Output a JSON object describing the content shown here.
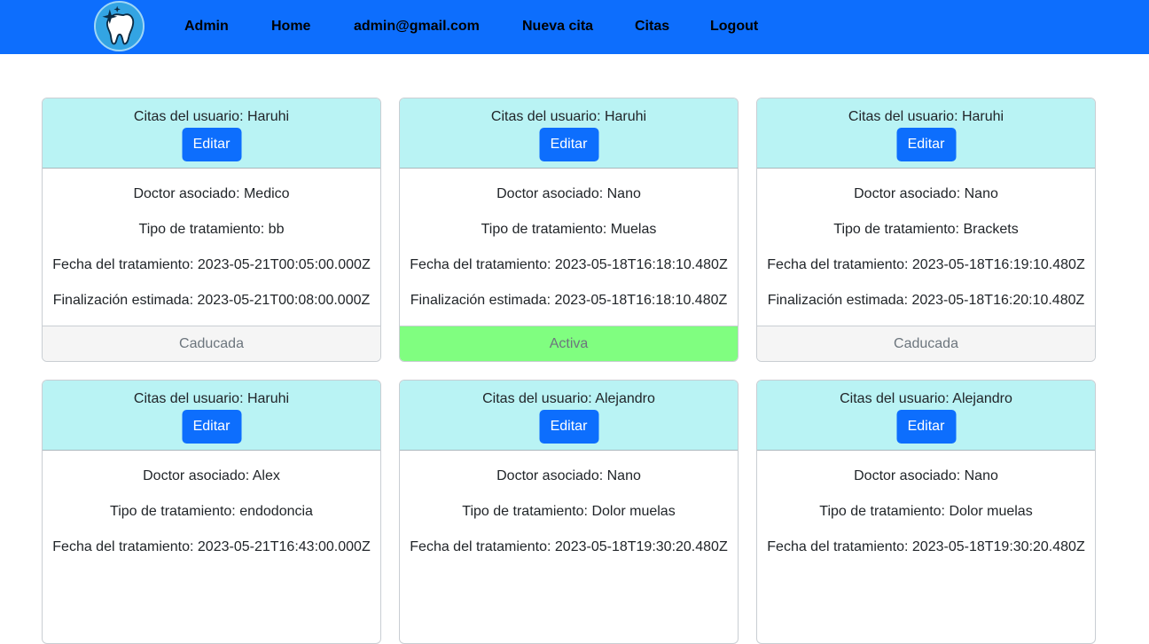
{
  "nav": {
    "logo_icon": "tooth-sparkle-icon",
    "items": [
      "Admin",
      "Home",
      "admin@gmail.com",
      "Nueva cita",
      "Citas",
      "Logout"
    ]
  },
  "colors": {
    "navbar": "#0d6efd",
    "card_header": "#b9f3f4",
    "button": "#0d6efd",
    "status_active": "#80fe80",
    "status_expired": "#f5f5f5"
  },
  "cards": [
    {
      "title": "Citas del usuario: Haruhi",
      "edit_label": "Editar",
      "doctor": "Doctor asociado: Medico",
      "treatment": "Tipo de tratamiento: bb",
      "date": "Fecha del tratamiento: 2023-05-21T00:05:00.000Z",
      "end": "Finalización estimada: 2023-05-21T00:08:00.000Z",
      "status": "Caducada"
    },
    {
      "title": "Citas del usuario: Haruhi",
      "edit_label": "Editar",
      "doctor": "Doctor asociado: Nano",
      "treatment": "Tipo de tratamiento: Muelas",
      "date": "Fecha del tratamiento: 2023-05-18T16:18:10.480Z",
      "end": "Finalización estimada: 2023-05-18T16:18:10.480Z",
      "status": "Activa"
    },
    {
      "title": "Citas del usuario: Haruhi",
      "edit_label": "Editar",
      "doctor": "Doctor asociado: Nano",
      "treatment": "Tipo de tratamiento: Brackets",
      "date": "Fecha del tratamiento: 2023-05-18T16:19:10.480Z",
      "end": "Finalización estimada: 2023-05-18T16:20:10.480Z",
      "status": "Caducada"
    },
    {
      "title": "Citas del usuario: Haruhi",
      "edit_label": "Editar",
      "doctor": "Doctor asociado: Alex",
      "treatment": "Tipo de tratamiento: endodoncia",
      "date": "Fecha del tratamiento: 2023-05-21T16:43:00.000Z"
    },
    {
      "title": "Citas del usuario: Alejandro",
      "edit_label": "Editar",
      "doctor": "Doctor asociado: Nano",
      "treatment": "Tipo de tratamiento: Dolor muelas",
      "date": "Fecha del tratamiento: 2023-05-18T19:30:20.480Z"
    },
    {
      "title": "Citas del usuario: Alejandro",
      "edit_label": "Editar",
      "doctor": "Doctor asociado: Nano",
      "treatment": "Tipo de tratamiento: Dolor muelas",
      "date": "Fecha del tratamiento: 2023-05-18T19:30:20.480Z"
    }
  ]
}
